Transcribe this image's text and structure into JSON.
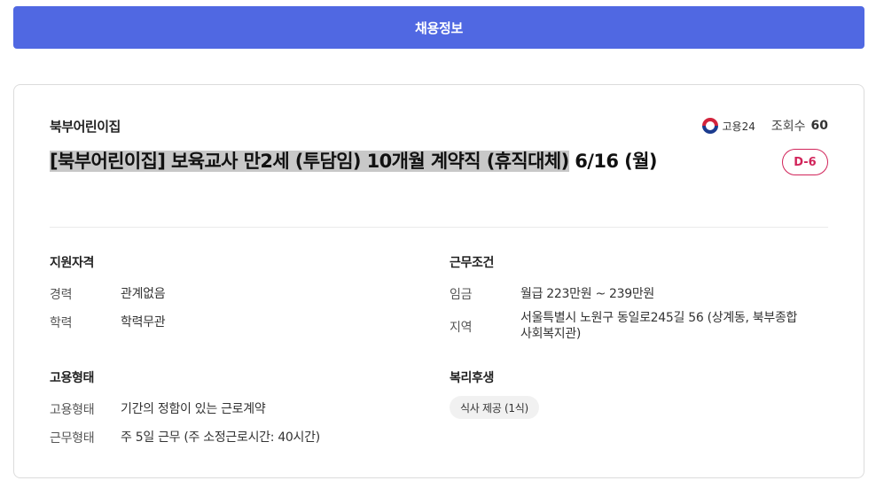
{
  "header": {
    "button_label": "채용정보"
  },
  "job": {
    "company": "북부어린이집",
    "source_label": "고용24",
    "views_label": "조회수",
    "views_count": "60",
    "title_highlighted": "[북부어린이집] 보육교사 만2세 (투담임) 10개월 계약직 (휴직대체)",
    "title_rest": " 6/16 (월)",
    "dday": "D-6"
  },
  "qualifications": {
    "title": "지원자격",
    "career_label": "경력",
    "career_value": "관계없음",
    "education_label": "학력",
    "education_value": "학력무관"
  },
  "conditions": {
    "title": "근무조건",
    "wage_label": "임금",
    "wage_value": "월급 223만원 ~ 239만원",
    "region_label": "지역",
    "region_value_line1": "서울특별시 노원구 동일로245길 56 (상계동, 북부종합",
    "region_value_line2": "사회복지관)"
  },
  "employment": {
    "title": "고용형태",
    "type_label": "고용형태",
    "type_value": "기간의 정함이 있는 근로계약",
    "work_label": "근무형태",
    "work_value": "주 5일 근무 (주 소정근로시간: 40시간)"
  },
  "welfare": {
    "title": "복리후생",
    "chip": "식사 제공 (1식)"
  },
  "icons": {
    "source_logo": "taegeuk-icon"
  }
}
